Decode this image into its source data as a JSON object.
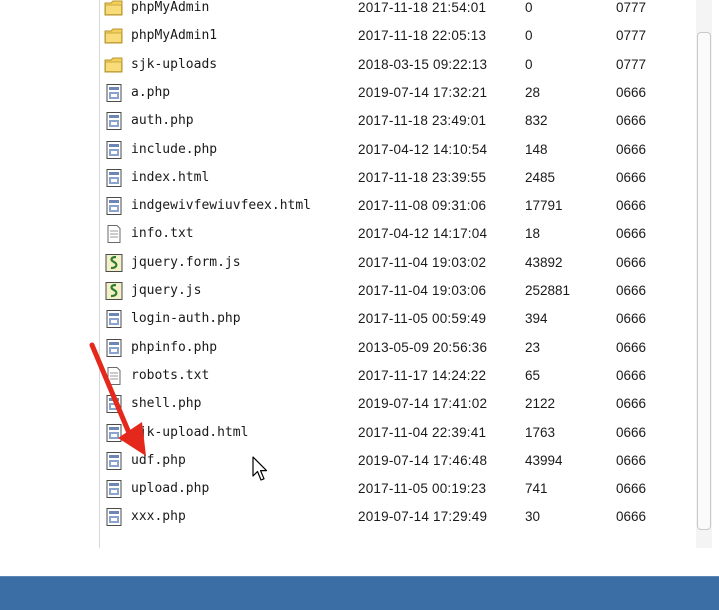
{
  "files": [
    {
      "icon": "folder-icon",
      "name": "phpMyAdmin",
      "date": "2017-11-18 21:54:01",
      "size": "0",
      "perm": "0777"
    },
    {
      "icon": "folder-icon",
      "name": "phpMyAdmin1",
      "date": "2017-11-18 22:05:13",
      "size": "0",
      "perm": "0777"
    },
    {
      "icon": "folder-icon",
      "name": "sjk-uploads",
      "date": "2018-03-15 09:22:13",
      "size": "0",
      "perm": "0777"
    },
    {
      "icon": "php-file-icon",
      "name": "a.php",
      "date": "2019-07-14 17:32:21",
      "size": "28",
      "perm": "0666"
    },
    {
      "icon": "php-file-icon",
      "name": "auth.php",
      "date": "2017-11-18 23:49:01",
      "size": "832",
      "perm": "0666"
    },
    {
      "icon": "php-file-icon",
      "name": "include.php",
      "date": "2017-04-12 14:10:54",
      "size": "148",
      "perm": "0666"
    },
    {
      "icon": "php-file-icon",
      "name": "index.html",
      "date": "2017-11-18 23:39:55",
      "size": "2485",
      "perm": "0666"
    },
    {
      "icon": "php-file-icon",
      "name": "indgewivfewiuvfeex.html",
      "date": "2017-11-08 09:31:06",
      "size": "17791",
      "perm": "0666"
    },
    {
      "icon": "text-file-icon",
      "name": "info.txt",
      "date": "2017-04-12 14:17:04",
      "size": "18",
      "perm": "0666"
    },
    {
      "icon": "js-file-icon",
      "name": "jquery.form.js",
      "date": "2017-11-04 19:03:02",
      "size": "43892",
      "perm": "0666"
    },
    {
      "icon": "js-file-icon",
      "name": "jquery.js",
      "date": "2017-11-04 19:03:06",
      "size": "252881",
      "perm": "0666"
    },
    {
      "icon": "php-file-icon",
      "name": "login-auth.php",
      "date": "2017-11-05 00:59:49",
      "size": "394",
      "perm": "0666"
    },
    {
      "icon": "php-file-icon",
      "name": "phpinfo.php",
      "date": "2013-05-09 20:56:36",
      "size": "23",
      "perm": "0666"
    },
    {
      "icon": "text-file-icon",
      "name": "robots.txt",
      "date": "2017-11-17 14:24:22",
      "size": "65",
      "perm": "0666"
    },
    {
      "icon": "php-file-icon",
      "name": "shell.php",
      "date": "2019-07-14 17:41:02",
      "size": "2122",
      "perm": "0666"
    },
    {
      "icon": "php-file-icon",
      "name": "sjk-upload.html",
      "date": "2017-11-04 22:39:41",
      "size": "1763",
      "perm": "0666"
    },
    {
      "icon": "php-file-icon",
      "name": "udf.php",
      "date": "2019-07-14 17:46:48",
      "size": "43994",
      "perm": "0666"
    },
    {
      "icon": "php-file-icon",
      "name": "upload.php",
      "date": "2017-11-05 00:19:23",
      "size": "741",
      "perm": "0666"
    },
    {
      "icon": "php-file-icon",
      "name": "xxx.php",
      "date": "2019-07-14 17:29:49",
      "size": "30",
      "perm": "0666"
    }
  ],
  "colors": {
    "folder": "#f2cf5b",
    "arrow": "#e5281c",
    "taskbar": "#3a6ea5"
  }
}
